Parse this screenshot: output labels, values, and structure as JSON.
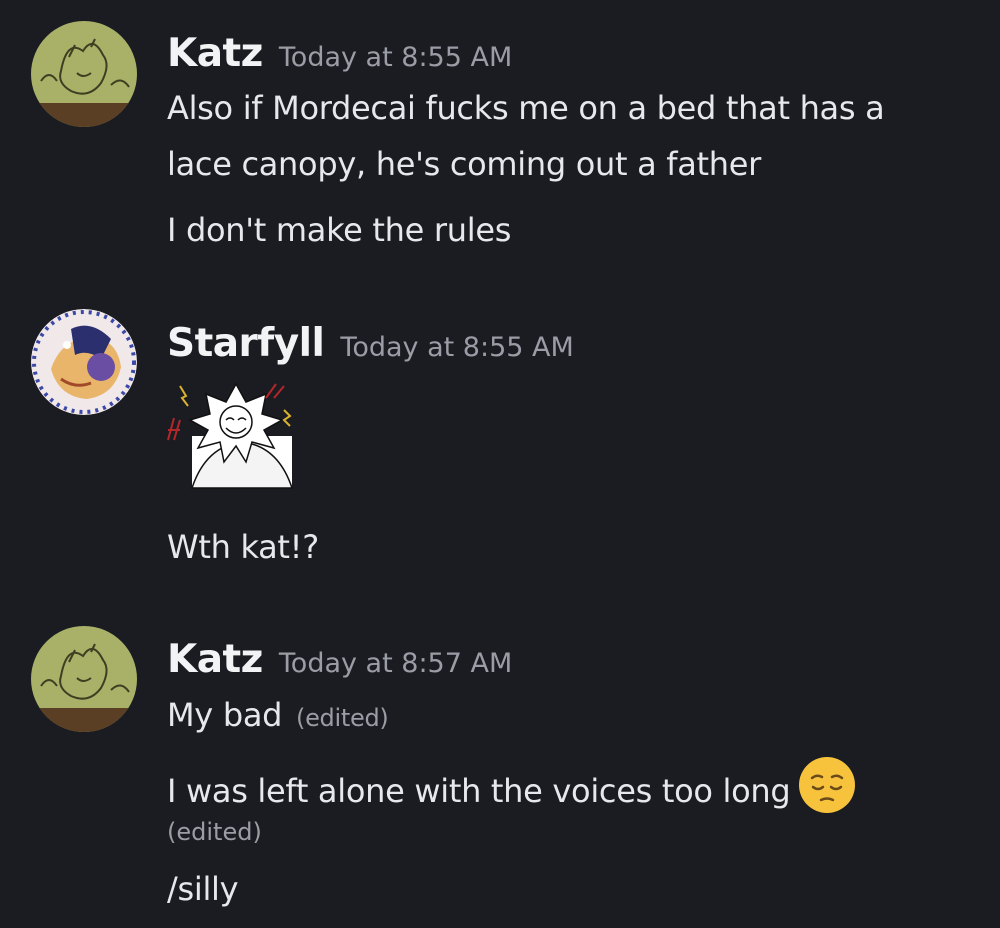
{
  "messages": [
    {
      "username": "Katz",
      "timestamp": "Today at 8:55 AM",
      "avatar_icon": "avatar-katz",
      "lines": [
        "Also if Mordecai fucks me on a bed that has a",
        "lace canopy, he's coming out a father",
        "I don't make the rules"
      ]
    },
    {
      "username": "Starfyll",
      "timestamp": "Today at 8:55 AM",
      "avatar_icon": "avatar-starfyll",
      "sticker_icon": "sun-character-sticker",
      "lines": [
        "Wth kat!?"
      ]
    },
    {
      "username": "Katz",
      "timestamp": "Today at 8:57 AM",
      "avatar_icon": "avatar-katz",
      "lines": [
        "My bad",
        "I was left alone with the voices too long",
        "/silly"
      ],
      "edited_label": "(edited)",
      "emoji_icon": "pensive-face-emoji"
    }
  ],
  "colors": {
    "background": "#1b1c21",
    "username": "#f2f3f5",
    "timestamp": "#9a9da6",
    "message_text": "#e6e8ec"
  }
}
